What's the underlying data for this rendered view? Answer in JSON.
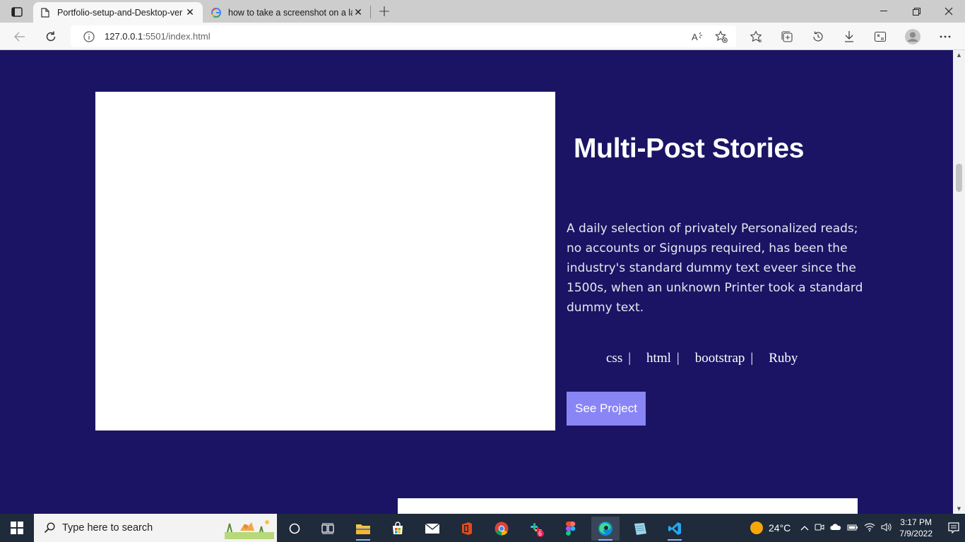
{
  "browser": {
    "tabs": [
      {
        "title": "Portfolio-setup-and-Desktop-ver",
        "active": true,
        "icon": "document-icon"
      },
      {
        "title": "how to take a screenshot on a la",
        "active": false,
        "icon": "google-icon"
      }
    ],
    "url_host": "127.0.0.1",
    "url_rest": ":5501/index.html"
  },
  "project": {
    "title": "Multi-Post Stories",
    "description": "A daily selection of privately Personalized reads; no accounts or Signups required, has been the industry's standard dummy text eveer since the 1500s, when an unknown Printer took a standard dummy text.",
    "tags": [
      "css",
      "html",
      "bootstrap",
      "Ruby"
    ],
    "tag_separator": "|",
    "button_label": "See Project",
    "button_color": "#8a85f5",
    "background_color": "#1b1464"
  },
  "taskbar": {
    "search_placeholder": "Type here to search",
    "weather": "24°C",
    "time": "3:17 PM",
    "date": "7/9/2022",
    "slack_badge": "6"
  }
}
